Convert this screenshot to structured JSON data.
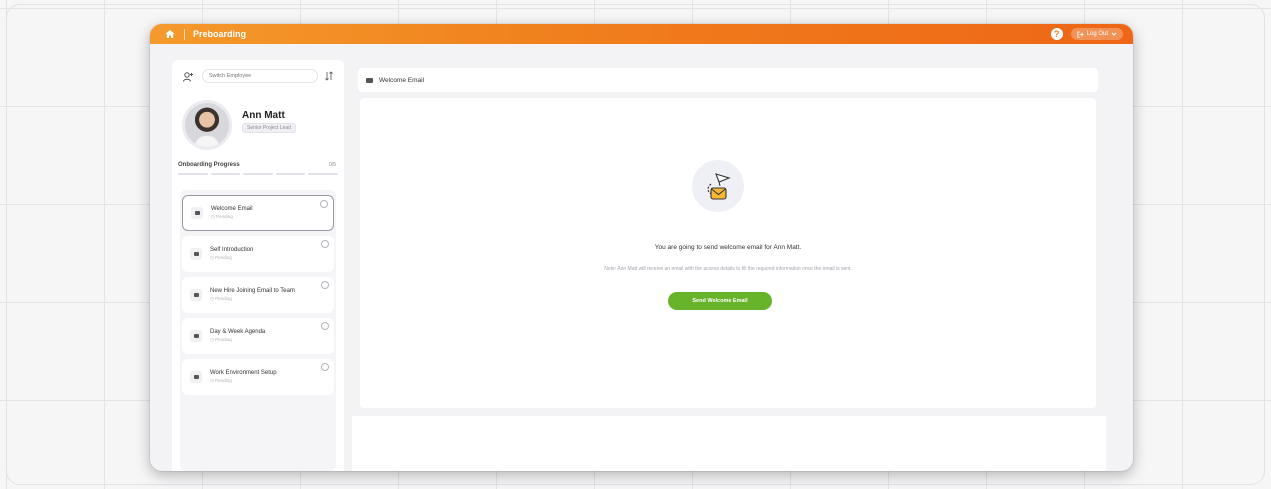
{
  "app": {
    "title": "Preboarding"
  },
  "topbar": {
    "help_label": "?",
    "logout_label": "Log Out",
    "accent": "#f07e1c"
  },
  "sidebar": {
    "search": {
      "placeholder": "Switch Employee"
    },
    "employee": {
      "name": "Ann Matt",
      "role": "Senior Project Lead"
    },
    "progress": {
      "label": "Onboarding Progress",
      "count": "0/5",
      "value": 0
    },
    "steps": [
      {
        "title": "Welcome Email",
        "status": "Pending",
        "icon": "mail-icon",
        "active": true
      },
      {
        "title": "Self Introduction",
        "status": "Pending",
        "icon": "intro-icon",
        "active": false
      },
      {
        "title": "New Hire Joining Email to Team",
        "status": "Pending",
        "icon": "mail-icon",
        "active": false
      },
      {
        "title": "Day & Week Agenda",
        "status": "Pending",
        "icon": "agenda-icon",
        "active": false
      },
      {
        "title": "Work Environment Setup",
        "status": "Pending",
        "icon": "document-icon",
        "active": false
      }
    ]
  },
  "main": {
    "header_title": "Welcome Email",
    "message": "You are going to send welcome email for Ann Matt.",
    "note": "Note: Ann Matt will receive an email with the access details to fill the required information once the email is sent.",
    "send_button": "Send Welcome Email",
    "button_color": "#67b32a"
  }
}
